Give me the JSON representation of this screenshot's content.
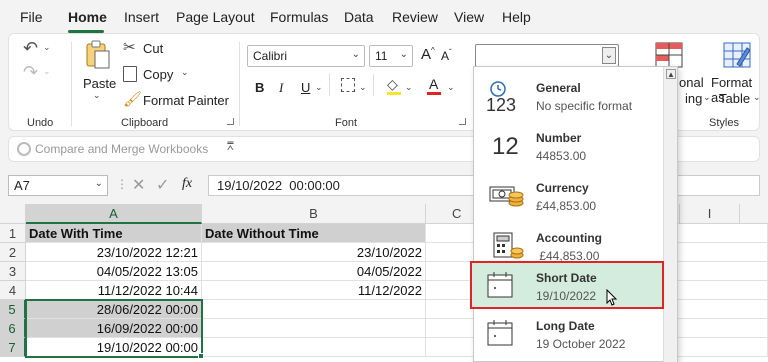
{
  "menu": [
    "File",
    "Home",
    "Insert",
    "Page Layout",
    "Formulas",
    "Data",
    "Review",
    "View",
    "Help"
  ],
  "ribbon": {
    "undo_label": "Undo",
    "paste_label": "Paste",
    "cut_label": "Cut",
    "copy_label": "Copy",
    "format_painter_label": "Format Painter",
    "clipboard_label": "Clipboard",
    "font_name": "Calibri",
    "font_size": "11",
    "font_label": "Font",
    "bold": "B",
    "italic": "I",
    "underline": "U",
    "grow": "A",
    "shrink": "A",
    "cond_format_partial_1": "onal",
    "cond_format_partial_2": "ing",
    "format_table_1": "Format as",
    "format_table_2": "Table",
    "styles_label": "Styles",
    "number_format_value": ""
  },
  "compare_bar": {
    "label": "Compare and Merge Workbooks"
  },
  "formula_bar": {
    "name_box": "A7",
    "fx": "fx",
    "value": "19/10/2022  00:00:00"
  },
  "columns": [
    "A",
    "B",
    "C",
    "I"
  ],
  "rows": [
    "1",
    "2",
    "3",
    "4",
    "5",
    "6",
    "7"
  ],
  "cells": {
    "A1": "Date With Time",
    "B1": "Date Without Time",
    "A2": "23/10/2022 12:21",
    "B2": "23/10/2022",
    "A3": "04/05/2022 13:05",
    "B3": "04/05/2022",
    "A4": "11/12/2022 10:44",
    "B4": "11/12/2022",
    "A5": "28/06/2022 00:00",
    "A6": "16/09/2022 00:00",
    "A7": "19/10/2022 00:00"
  },
  "number_formats": [
    {
      "title": "General",
      "sample": "No specific format",
      "icon": "clock-123-icon",
      "icon_text": "123"
    },
    {
      "title": "Number",
      "sample": "44853.00",
      "icon": "number-12-icon",
      "icon_text": "12"
    },
    {
      "title": "Currency",
      "sample": "£44,853.00",
      "icon": "currency-icon",
      "icon_text": ""
    },
    {
      "title": "Accounting",
      "sample": " £44,853.00",
      "icon": "accounting-calculator-icon",
      "icon_text": ""
    },
    {
      "title": "Short Date",
      "sample": "19/10/2022",
      "icon": "calendar-icon",
      "icon_text": ""
    },
    {
      "title": "Long Date",
      "sample": "19 October 2022",
      "icon": "calendar-icon",
      "icon_text": ""
    }
  ],
  "colors": {
    "accent": "#217346",
    "highlight_bg": "#d3ecdd",
    "highlight_border": "#e02424",
    "font_color_bar": "#e02424"
  }
}
